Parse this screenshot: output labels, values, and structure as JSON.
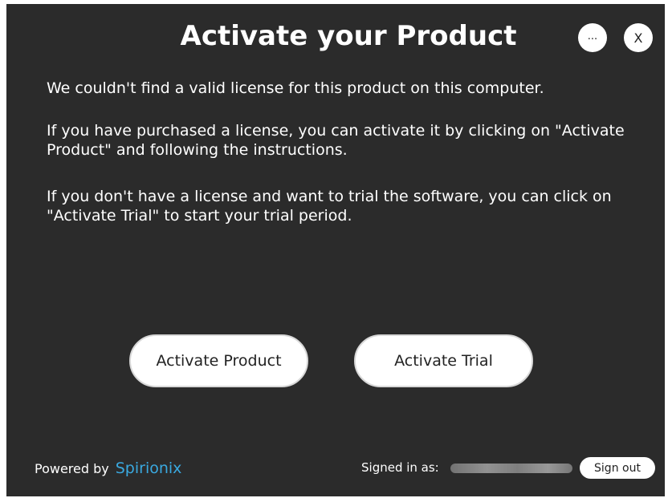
{
  "dialog": {
    "title": "Activate your Product",
    "more_label": "...",
    "close_label": "X",
    "messages": [
      "We couldn't find a valid license for this product on this computer.",
      "If you have purchased a license, you can activate it by clicking on \"Activate Product\" and following the instructions.",
      "If you don't have a license and want to trial the software, you can click on \"Activate Trial\" to start your trial period."
    ],
    "activate_product_label": "Activate Product",
    "activate_trial_label": "Activate Trial"
  },
  "footer": {
    "powered_by_label": "Powered by",
    "brand_name": "Spirionix",
    "signed_in_label": "Signed in as:",
    "sign_out_label": "Sign out"
  },
  "colors": {
    "background": "#2b2b2b",
    "brand": "#3aa9e0",
    "button": "#ffffff"
  }
}
